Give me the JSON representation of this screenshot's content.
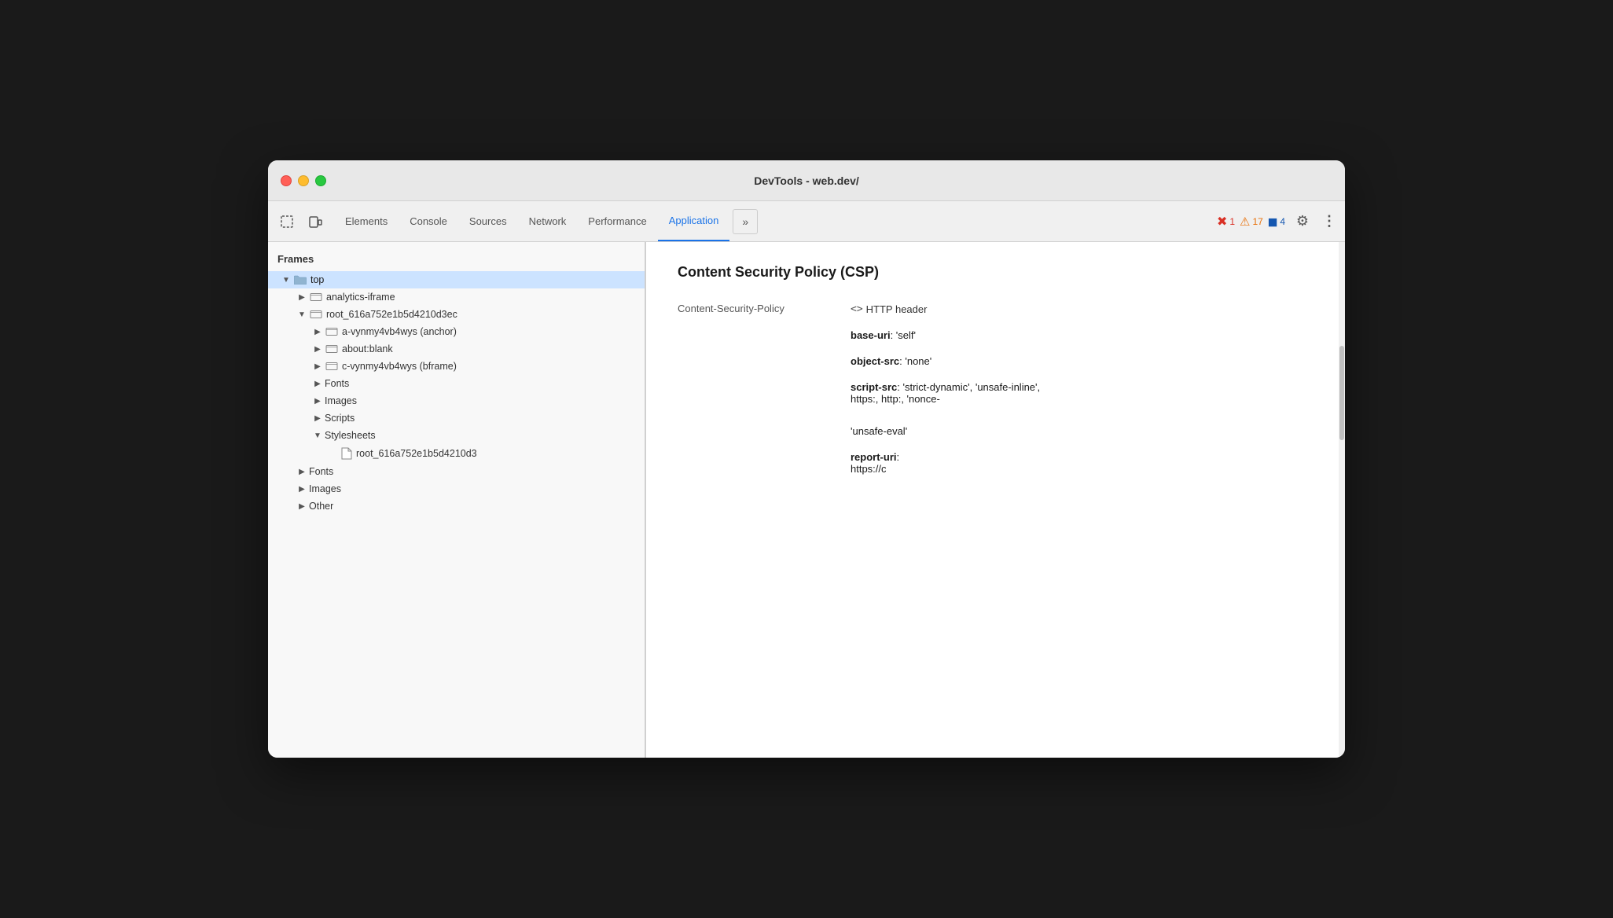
{
  "window": {
    "title": "DevTools - web.dev/"
  },
  "toolbar": {
    "icons": [
      {
        "name": "select-icon",
        "symbol": "⬚"
      },
      {
        "name": "device-icon",
        "symbol": "▭"
      }
    ],
    "tabs": [
      {
        "id": "elements",
        "label": "Elements",
        "active": false
      },
      {
        "id": "console",
        "label": "Console",
        "active": false
      },
      {
        "id": "sources",
        "label": "Sources",
        "active": false
      },
      {
        "id": "network",
        "label": "Network",
        "active": false
      },
      {
        "id": "performance",
        "label": "Performance",
        "active": false
      },
      {
        "id": "application",
        "label": "Application",
        "active": true
      }
    ],
    "more_tabs_symbol": "»",
    "error_count": "1",
    "warn_count": "17",
    "info_count": "4",
    "gear_symbol": "⚙",
    "more_symbol": "⋮"
  },
  "sidebar": {
    "header": "Frames",
    "items": [
      {
        "id": "top",
        "label": "top",
        "level": 1,
        "type": "folder",
        "expanded": true,
        "selected": true,
        "chevron": "▼"
      },
      {
        "id": "analytics-iframe",
        "label": "analytics-iframe",
        "level": 2,
        "type": "folder",
        "expanded": false,
        "chevron": "▶"
      },
      {
        "id": "root-main",
        "label": "root_616a752e1b5d4210d3ec",
        "level": 2,
        "type": "folder",
        "expanded": true,
        "chevron": "▼"
      },
      {
        "id": "a-vynmy4vb4wys",
        "label": "a-vynmy4vb4wys (anchor)",
        "level": 3,
        "type": "folder",
        "expanded": false,
        "chevron": "▶"
      },
      {
        "id": "about-blank",
        "label": "about:blank",
        "level": 3,
        "type": "folder",
        "expanded": false,
        "chevron": "▶"
      },
      {
        "id": "c-vynmy4vb4wys",
        "label": "c-vynmy4vb4wys (bframe)",
        "level": 3,
        "type": "folder",
        "expanded": false,
        "chevron": "▶"
      },
      {
        "id": "fonts-sub",
        "label": "Fonts",
        "level": 3,
        "type": "group",
        "expanded": false,
        "chevron": "▶"
      },
      {
        "id": "images-sub",
        "label": "Images",
        "level": 3,
        "type": "group",
        "expanded": false,
        "chevron": "▶"
      },
      {
        "id": "scripts-sub",
        "label": "Scripts",
        "level": 3,
        "type": "group",
        "expanded": false,
        "chevron": "▶"
      },
      {
        "id": "stylesheets-sub",
        "label": "Stylesheets",
        "level": 3,
        "type": "group",
        "expanded": true,
        "chevron": "▼"
      },
      {
        "id": "stylesheet-file",
        "label": "root_616a752e1b5d4210d3",
        "level": 4,
        "type": "file",
        "chevron": ""
      },
      {
        "id": "fonts-top",
        "label": "Fonts",
        "level": 2,
        "type": "group",
        "expanded": false,
        "chevron": "▶"
      },
      {
        "id": "images-top",
        "label": "Images",
        "level": 2,
        "type": "group",
        "expanded": false,
        "chevron": "▶"
      },
      {
        "id": "other-top",
        "label": "Other",
        "level": 2,
        "type": "group",
        "expanded": false,
        "chevron": "▶"
      }
    ]
  },
  "content": {
    "title": "Content Security Policy (CSP)",
    "label": "Content-Security-Policy",
    "http_header_symbol": "<>",
    "http_header_text": "HTTP header",
    "directives": [
      {
        "key": "base-uri",
        "value": ":'self'"
      },
      {
        "key": "object-src",
        "value": ": 'none'"
      },
      {
        "key": "script-src",
        "value": ": 'strict-dynamic', 'unsafe-inline',"
      },
      {
        "key": "",
        "value": "https:, http:, 'nonce-"
      },
      {
        "key": "",
        "value": ""
      },
      {
        "key": "",
        "value": "'unsafe-eval'"
      },
      {
        "key": "report-uri",
        "value": ":"
      },
      {
        "key": "",
        "value": "https://c"
      }
    ]
  }
}
